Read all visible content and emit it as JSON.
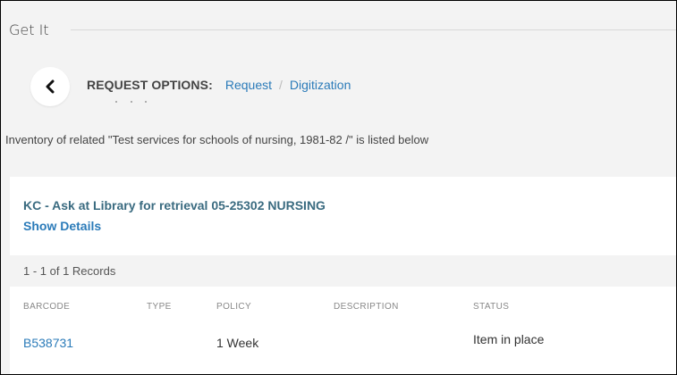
{
  "section": {
    "title": "Get It"
  },
  "request_options": {
    "label": "REQUEST OPTIONS:",
    "links": [
      "Request",
      "Digitization"
    ],
    "separator": "/"
  },
  "inventory_note": "Inventory of related \"Test services for schools of nursing, 1981-82 /\" is listed below",
  "holding": {
    "location": "KC - Ask at Library for retrieval  05-25302 NURSING",
    "show_details": "Show Details",
    "records_count": "1 - 1 of 1 Records",
    "columns": {
      "barcode": "BARCODE",
      "type": "TYPE",
      "policy": "POLICY",
      "description": "DESCRIPTION",
      "status": "STATUS"
    },
    "items": [
      {
        "barcode": "B538731",
        "type": "",
        "policy": "1 Week",
        "description": "",
        "status": "Item in place"
      }
    ]
  },
  "icons": {
    "back": "chevron-left-icon"
  },
  "colors": {
    "link": "#2b7bb9",
    "location": "#3a6b80",
    "background": "#f3f3f3"
  }
}
